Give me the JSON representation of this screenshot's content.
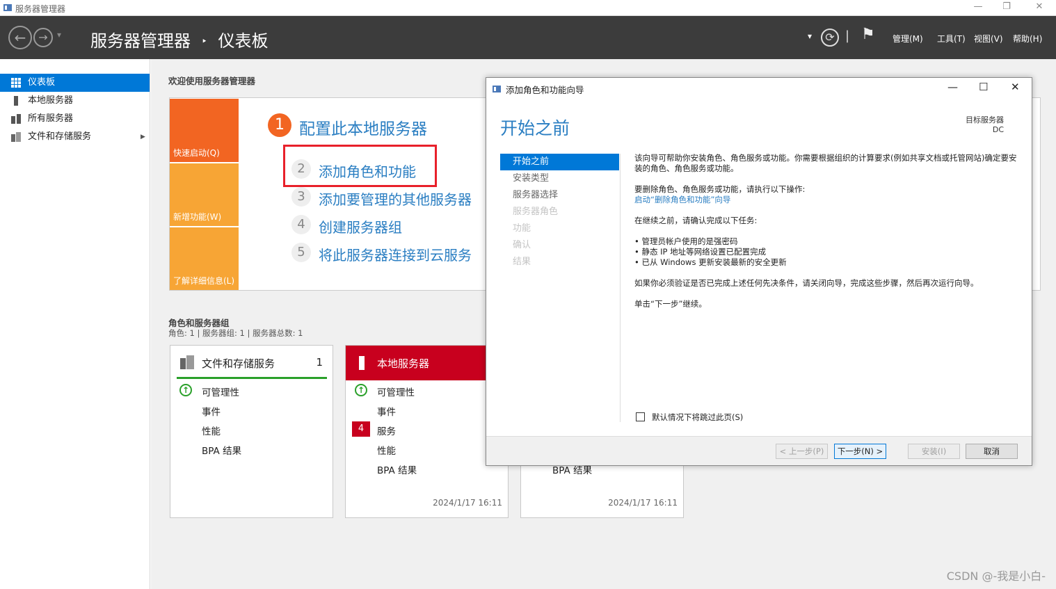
{
  "window": {
    "title": "服务器管理器",
    "minimize": "—",
    "restore": "❐",
    "close": "✕"
  },
  "header": {
    "back": "←",
    "forward": "→",
    "breadcrumb_root": "服务器管理器",
    "breadcrumb_sep": "‣",
    "breadcrumb_page": "仪表板",
    "dropdown": "▾",
    "refresh": "⟳",
    "sep": "|",
    "flag": "⚑",
    "menus": [
      "管理(M)",
      "工具(T)",
      "视图(V)",
      "帮助(H)"
    ]
  },
  "sidebar": {
    "items": [
      {
        "label": "仪表板",
        "selected": true
      },
      {
        "label": "本地服务器"
      },
      {
        "label": "所有服务器"
      },
      {
        "label": "文件和存储服务",
        "chevron": "▶"
      }
    ]
  },
  "welcome": {
    "title": "欢迎使用服务器管理器",
    "quick": [
      "快速启动(Q)",
      "新增功能(W)",
      "了解详细信息(L)"
    ],
    "steps": [
      {
        "n": "1",
        "label": "配置此本地服务器"
      },
      {
        "n": "2",
        "label": "添加角色和功能"
      },
      {
        "n": "3",
        "label": "添加要管理的其他服务器"
      },
      {
        "n": "4",
        "label": "创建服务器组"
      },
      {
        "n": "5",
        "label": "将此服务器连接到云服务"
      }
    ]
  },
  "roles": {
    "title": "角色和服务器组",
    "subtitle": "角色: 1 | 服务器组: 1 | 服务器总数: 1"
  },
  "tiles": [
    {
      "title": "文件和存储服务",
      "count": "1",
      "rows": [
        "可管理性",
        "事件",
        "性能",
        "BPA 结果"
      ],
      "time": "2024/1/17 16:11"
    },
    {
      "title": "本地服务器",
      "badge": "4",
      "rows": [
        "可管理性",
        "事件",
        "服务",
        "性能",
        "BPA 结果"
      ],
      "time": "2024/1/17 16:11"
    },
    {
      "rows": [
        "BPA 结果"
      ],
      "time": "2024/1/17 16:11"
    }
  ],
  "dialog": {
    "title": "添加角色和功能向导",
    "minimize": "—",
    "maximize": "☐",
    "close": "✕",
    "heading": "开始之前",
    "target_label": "目标服务器",
    "target_value": "DC",
    "nav": [
      "开始之前",
      "安装类型",
      "服务器选择",
      "服务器角色",
      "功能",
      "确认",
      "结果"
    ],
    "body": {
      "p1": "该向导可帮助你安装角色、角色服务或功能。你需要根据组织的计算要求(例如共享文档或托管网站)确定要安装的角色、角色服务或功能。",
      "p2": "要删除角色、角色服务或功能，请执行以下操作:",
      "link": "启动“删除角色和功能”向导",
      "p3": "在继续之前，请确认完成以下任务:",
      "bullets": [
        "管理员帐户使用的是强密码",
        "静态 IP 地址等网络设置已配置完成",
        "已从 Windows 更新安装最新的安全更新"
      ],
      "p4": "如果你必须验证是否已完成上述任何先决条件，请关闭向导，完成这些步骤，然后再次运行向导。",
      "p5": "单击“下一步”继续。"
    },
    "skip_label": "默认情况下将跳过此页(S)",
    "buttons": {
      "prev": "< 上一步(P)",
      "next": "下一步(N) >",
      "install": "安装(I)",
      "cancel": "取消"
    }
  },
  "watermark": "CSDN @-我是小白-",
  "colors": {
    "accent": "#0078d7",
    "orange": "#f26522",
    "orange_light": "#f7a535",
    "red": "#c8001e",
    "green": "#2aa02a"
  }
}
